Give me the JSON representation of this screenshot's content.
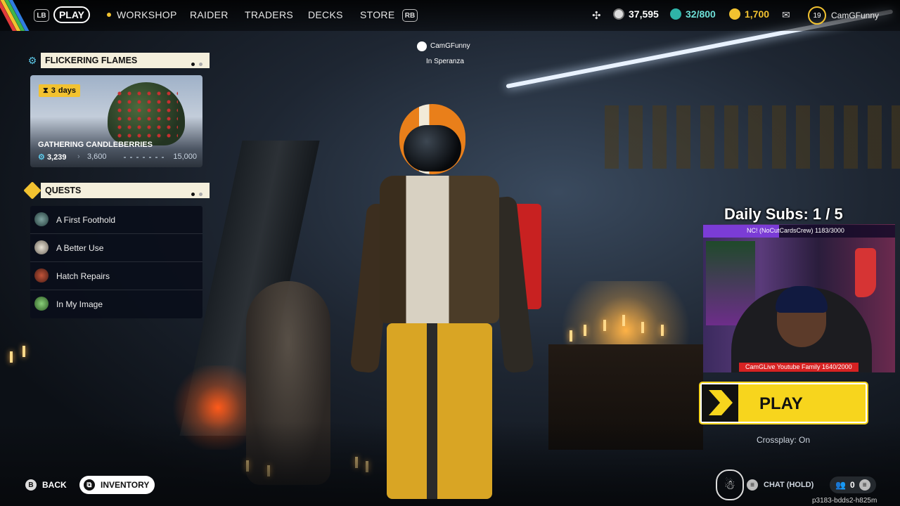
{
  "topbar": {
    "lb": "LB",
    "rb": "RB",
    "nav": [
      "PLAY",
      "WORKSHOP",
      "RAIDER",
      "TRADERS",
      "DECKS",
      "STORE"
    ],
    "stats": {
      "currency_1": "37,595",
      "currency_2": "32/800",
      "currency_3": "1,700"
    },
    "level": "19",
    "username": "CamGFunny"
  },
  "player_tag": {
    "name": "CamGFunny",
    "location": "In Speranza"
  },
  "event": {
    "header": "FLICKERING FLAMES",
    "timer_value": "3",
    "timer_unit": "days",
    "title": "GATHERING CANDLEBERRIES",
    "progress_current": "3,239",
    "progress_mid": "3,600",
    "progress_max": "15,000"
  },
  "quests": {
    "header": "QUESTS",
    "items": [
      {
        "label": "A First Foothold",
        "icon": "quest-giver-portrait-icon"
      },
      {
        "label": "A Better Use",
        "icon": "quest-giver-portrait-icon"
      },
      {
        "label": "Hatch Repairs",
        "icon": "quest-giver-portrait-icon"
      },
      {
        "label": "In My Image",
        "icon": "quest-giver-portrait-icon"
      }
    ]
  },
  "overlay": {
    "daily_subs": "Daily Subs: 1 / 5",
    "sub_goal_text": "NC! (NoCutCardsCrew) 1183/3000",
    "sub_goal_fraction": 0.394,
    "family_goal_text": "CamGLive Youtube Family 1640/2000"
  },
  "play_button": {
    "label": "PLAY",
    "crossplay": "Crossplay: On"
  },
  "bottom": {
    "back_key": "B",
    "back_label": "BACK",
    "inventory_label": "INVENTORY",
    "chat_label": "CHAT (HOLD)",
    "party_count": "0",
    "session_id": "p3183-bdds2-h825m"
  },
  "colors": {
    "accent_yellow": "#f7d51d",
    "panel_header": "#f4efdc",
    "quest_panel_bg": "#0a0e1a"
  }
}
